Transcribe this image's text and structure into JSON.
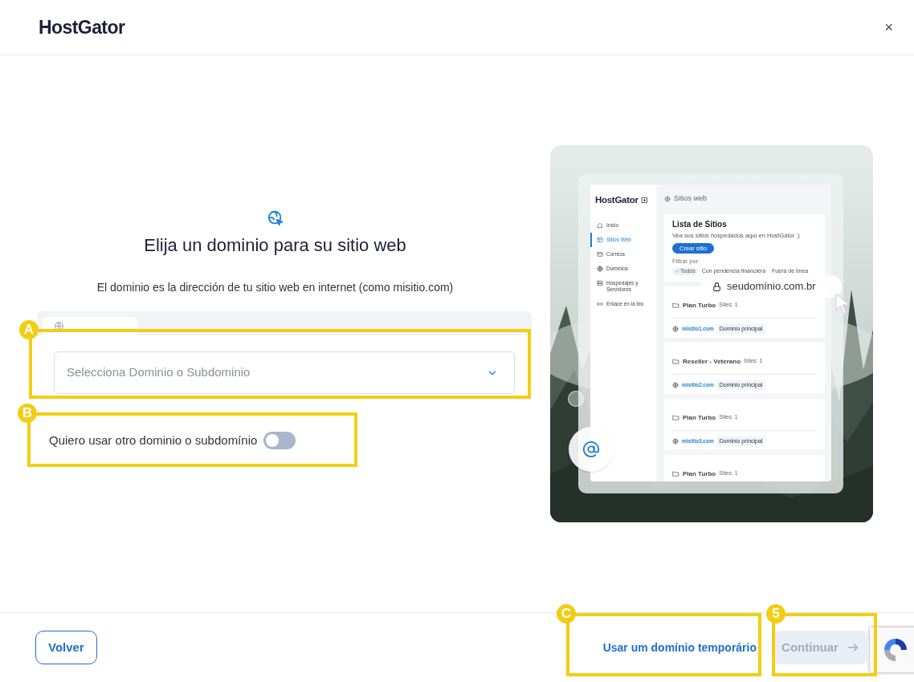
{
  "header": {
    "logo": "HostGator",
    "close": "×"
  },
  "intro": {
    "title": "Elija un dominio para su sitio web",
    "subtitle": "El dominio es la dirección de tu sitio web en internet (como misitio.com)"
  },
  "domain_select": {
    "placeholder": "Selecciona Dominio o Subdominio"
  },
  "other_domain_toggle": {
    "label": "Quiero usar otro dominio o subdomínio",
    "on": false
  },
  "illustration": {
    "logo": "HostGator",
    "header": "Sitios web",
    "nav": [
      {
        "label": "Inicio",
        "selected": false
      },
      {
        "label": "Sitios Web",
        "selected": true
      },
      {
        "label": "Correos",
        "selected": false
      },
      {
        "label": "Dominios",
        "selected": false
      },
      {
        "label": "Hospedajes y Servidores",
        "selected": false
      },
      {
        "label": "Enlace en la bio",
        "selected": false
      }
    ],
    "list_title": "Lista de Sitios",
    "list_subtitle": "Vea sus sitios hospedados aquí en HostGator :)",
    "create_button": "Crear sitio",
    "filter_label": "Filtrar por:",
    "filters": [
      {
        "label": "Todos",
        "selected": true
      },
      {
        "label": "Con pendencia financiera",
        "selected": false
      },
      {
        "label": "Fuera de línea",
        "selected": false
      }
    ],
    "url_pill": "seudomínio.com.br",
    "sites": [
      {
        "plan": "Plan Turbo",
        "count": "Sites: 1",
        "domain": "misitio1.com",
        "badge": "Dominio principal"
      },
      {
        "plan": "Reseller - Veterano",
        "count": "Sites: 1",
        "domain": "misitio2.com",
        "badge": "Dominio principal"
      },
      {
        "plan": "Plan Turbo",
        "count": "Sites: 1",
        "domain": "misitio3.com",
        "badge": "Dominio principal"
      },
      {
        "plan": "Plan Turbo",
        "count": "Sites: 1"
      }
    ]
  },
  "footer": {
    "back": "Volver",
    "temporary_link": "Usar um domínio temporário",
    "continue": {
      "label": "Continuar",
      "disabled": true
    }
  },
  "annotations": [
    {
      "label": "A"
    },
    {
      "label": "B"
    },
    {
      "label": "C"
    },
    {
      "label": "5"
    }
  ]
}
